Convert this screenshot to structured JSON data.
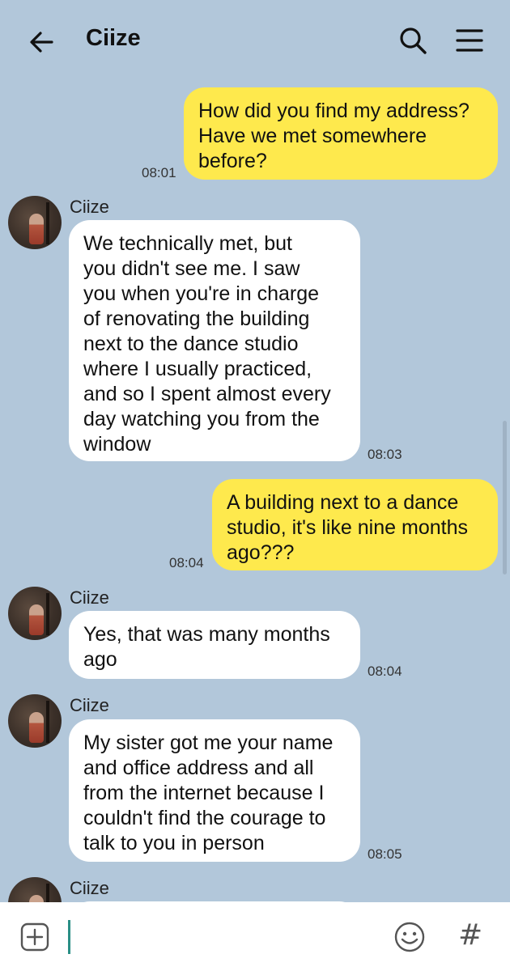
{
  "header": {
    "title": "Ciize",
    "back_icon": "arrow-left-icon",
    "search_icon": "search-icon",
    "menu_icon": "hamburger-menu-icon"
  },
  "messages": [
    {
      "from": "me",
      "lines": [
        "How did you find my address?",
        "Have we met somewhere",
        "before?"
      ],
      "time": "08:01"
    },
    {
      "from": "them",
      "sender": "Ciize",
      "lines": [
        "We technically met, but",
        "you didn't see me. I saw",
        "you when you're in charge",
        "of renovating the building",
        "next to the dance studio",
        "where I usually practiced,",
        "and so I spent almost every",
        "day watching you from the",
        "window"
      ],
      "time": "08:03"
    },
    {
      "from": "me",
      "lines": [
        "A building next to a dance",
        "studio, it's like nine months",
        "ago???"
      ],
      "time": "08:04"
    },
    {
      "from": "them",
      "sender": "Ciize",
      "lines": [
        "Yes, that was many months",
        "ago"
      ],
      "time": "08:04"
    },
    {
      "from": "them",
      "sender": "Ciize",
      "lines": [
        "My sister got me your name",
        "and office address and all",
        "from the internet because I",
        "couldn't find the courage to",
        "talk to you in person"
      ],
      "time": "08:05"
    },
    {
      "from": "them",
      "sender": "Ciize",
      "lines": [],
      "time": ""
    }
  ],
  "input": {
    "add_icon": "plus-square-icon",
    "emoji_icon": "smiley-icon",
    "hash_label": "#"
  },
  "colors": {
    "background": "#b2c7da",
    "my_bubble": "#fee94d",
    "their_bubble": "#ffffff",
    "cursor": "#2a8f86"
  }
}
